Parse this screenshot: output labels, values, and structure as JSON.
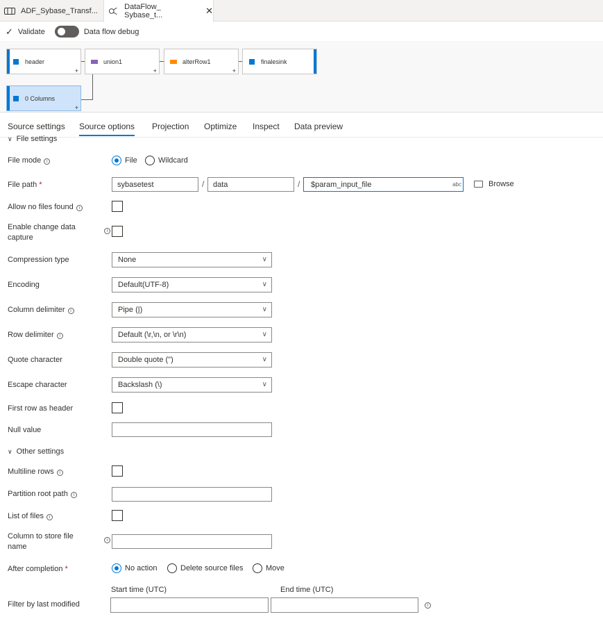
{
  "tabs": [
    {
      "label": "ADF_Sybase_Transf...",
      "icon": "pipeline-icon"
    },
    {
      "label": "DataFlow_ Sybase_t...",
      "icon": "dataflow-icon"
    }
  ],
  "toolbar": {
    "validate_label": "Validate",
    "debug_label": "Data flow debug"
  },
  "canvas": {
    "nodes": [
      {
        "label": "header"
      },
      {
        "label": "union1"
      },
      {
        "label": "alterRow1"
      },
      {
        "label": "finalesink"
      },
      {
        "label": "0 Columns"
      }
    ],
    "plus": "+"
  },
  "settings_tabs": [
    "Source settings",
    "Source options",
    "Projection",
    "Optimize",
    "Inspect",
    "Data preview"
  ],
  "form": {
    "file_settings_section": "File settings",
    "file_mode": {
      "label": "File mode",
      "opt1": "File",
      "opt2": "Wildcard"
    },
    "file_path": {
      "label": "File path",
      "container": "sybasetest",
      "directory": "data",
      "file": "$param_input_file",
      "abc": "abc",
      "browse": "Browse"
    },
    "allow_no_files": "Allow no files found",
    "enable_cdc": "Enable change data capture",
    "compression": {
      "label": "Compression type",
      "value": "None"
    },
    "encoding": {
      "label": "Encoding",
      "value": "Default(UTF-8)"
    },
    "column_delimiter": {
      "label": "Column delimiter",
      "value": "Pipe (|)"
    },
    "row_delimiter": {
      "label": "Row delimiter",
      "value": "Default (\\r,\\n, or \\r\\n)"
    },
    "quote_char": {
      "label": "Quote character",
      "value": "Double quote (\")"
    },
    "escape_char": {
      "label": "Escape character",
      "value": "Backslash (\\)"
    },
    "first_row_header": "First row as header",
    "null_value": "Null value",
    "other_settings_section": "Other settings",
    "multiline_rows": "Multiline rows",
    "partition_root_path": "Partition root path",
    "list_of_files": "List of files",
    "column_store_file_name": "Column to store file name",
    "after_completion": {
      "label": "After completion",
      "opt1": "No action",
      "opt2": "Delete source files",
      "opt3": "Move"
    },
    "filter_last_modified": {
      "label": "Filter by last modified",
      "start": "Start time (UTC)",
      "end": "End time (UTC)"
    }
  },
  "colors": {
    "accent": "#0078d4",
    "required": "#a4262c"
  }
}
